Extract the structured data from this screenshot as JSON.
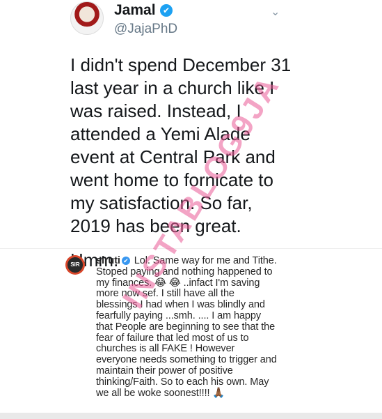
{
  "tweet": {
    "name": "Jamal",
    "verified_mark": "✔",
    "handle": "@JajaPhD",
    "menu_icon": "chevron-down-icon",
    "paragraphs": [
      "I didn't spend December 31 last year in a church like I was raised. Instead, I attended a Yemi Alade event at Central Park and went home to fornicate to my satisfaction. So far, 2019 has been great.",
      "Hmm."
    ]
  },
  "comment": {
    "username": "siruti",
    "verified_mark": "✔",
    "avatar_text": "SIR",
    "text": "Lol. Same way for me and Tithe. Stoped paying and nothing happened to my finances. 😂 😂 ..infact I'm saving more now sef. I still have all the blessings I had when I was blindly and fearfully paying ...smh. .... I am happy that People are beginning to see that the fear of failure that led most of us to churches is all FAKE ! However everyone needs something to trigger and maintain their power of positive thinking/Faith. So to each his own. May we all be woke soonest!!!! 🙏🏾"
  },
  "watermark": "INSTABLOG9JA",
  "colors": {
    "verified_blue": "#1da1f2",
    "handle_gray": "#657786",
    "watermark_pink": "#e95a96"
  }
}
